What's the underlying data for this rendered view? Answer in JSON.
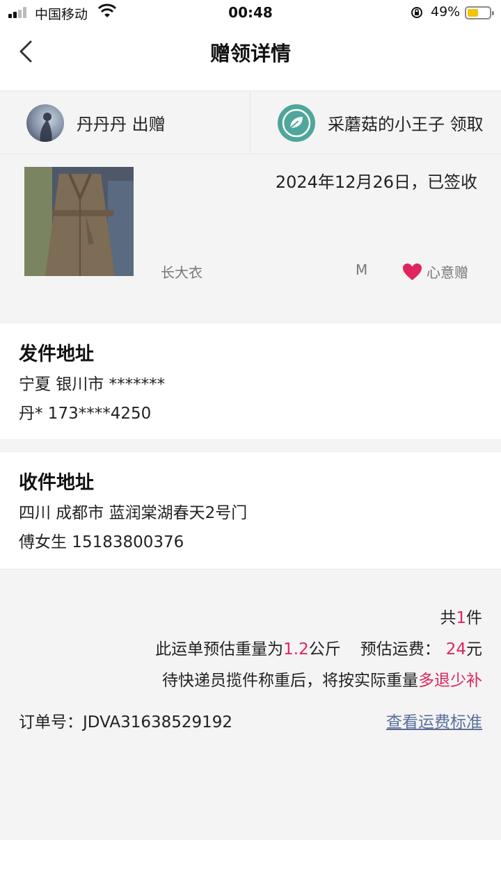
{
  "status_bar": {
    "carrier": "中国移动",
    "time": "00:48",
    "battery_pct": "49%",
    "battery_color": "#f5c400"
  },
  "nav": {
    "title": "赠领详情",
    "back_icon": "chevron-left-icon"
  },
  "giver": {
    "label": "丹丹丹 出赠"
  },
  "receiver": {
    "label": "采蘑菇的小王子 领取"
  },
  "item": {
    "status": "2024年12月26日，已签收",
    "name": "长大衣",
    "size": "M",
    "type_label": "心意赠",
    "type_icon": "heart-icon",
    "heart_color": "#e0245e"
  },
  "sender_address": {
    "title": "发件地址",
    "location": "宁夏 银川市 *******",
    "contact": "丹* 173****4250"
  },
  "receiver_address": {
    "title": "收件地址",
    "location": "四川 成都市 蓝润棠湖春天2号门",
    "contact": "傅女生 15183800376"
  },
  "shipping": {
    "count_prefix": "共",
    "count": "1",
    "count_suffix": "件",
    "weight_prefix": "此运单预估重量为",
    "weight": "1.2",
    "weight_unit": "公斤",
    "fee_prefix": "预估运费：",
    "fee": "24",
    "fee_unit": "元",
    "note_prefix": "待快递员揽件称重后，将按实际重量",
    "note_highlight": "多退少补",
    "highlight_color": "#e0245e"
  },
  "order": {
    "label": "订单号：",
    "number": "JDVA31638529192",
    "fee_link": "查看运费标准"
  }
}
